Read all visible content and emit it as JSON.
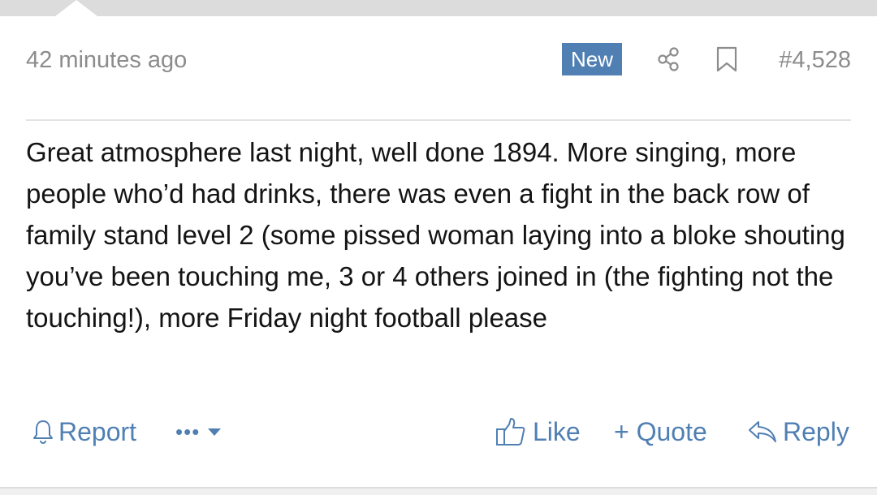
{
  "post": {
    "timestamp": "42 minutes ago",
    "badge": "New",
    "post_number": "#4,528",
    "message": "Great atmosphere last night, well done 1894. More singing, more people who’d had drinks, there was even a fight in the back row of family stand level 2 (some pissed woman laying into a bloke shouting you’ve been touching me, 3 or 4 others joined in (the fighting not the touching!), more Friday night football please"
  },
  "actions": {
    "report": "Report",
    "more": "•••",
    "like": "Like",
    "quote": "+ Quote",
    "reply": "Reply"
  },
  "icons": {
    "share": "share-icon",
    "bookmark": "bookmark-icon",
    "report": "bell-icon",
    "more_caret": "caret-down-icon",
    "like": "thumbs-up-icon",
    "reply": "reply-arrow-icon"
  },
  "colors": {
    "accent": "#4f7fb3",
    "badge_bg": "#4f7fb3",
    "meta_text": "#8c8c8c",
    "body_text": "#141414",
    "band": "#dcdcdc"
  }
}
